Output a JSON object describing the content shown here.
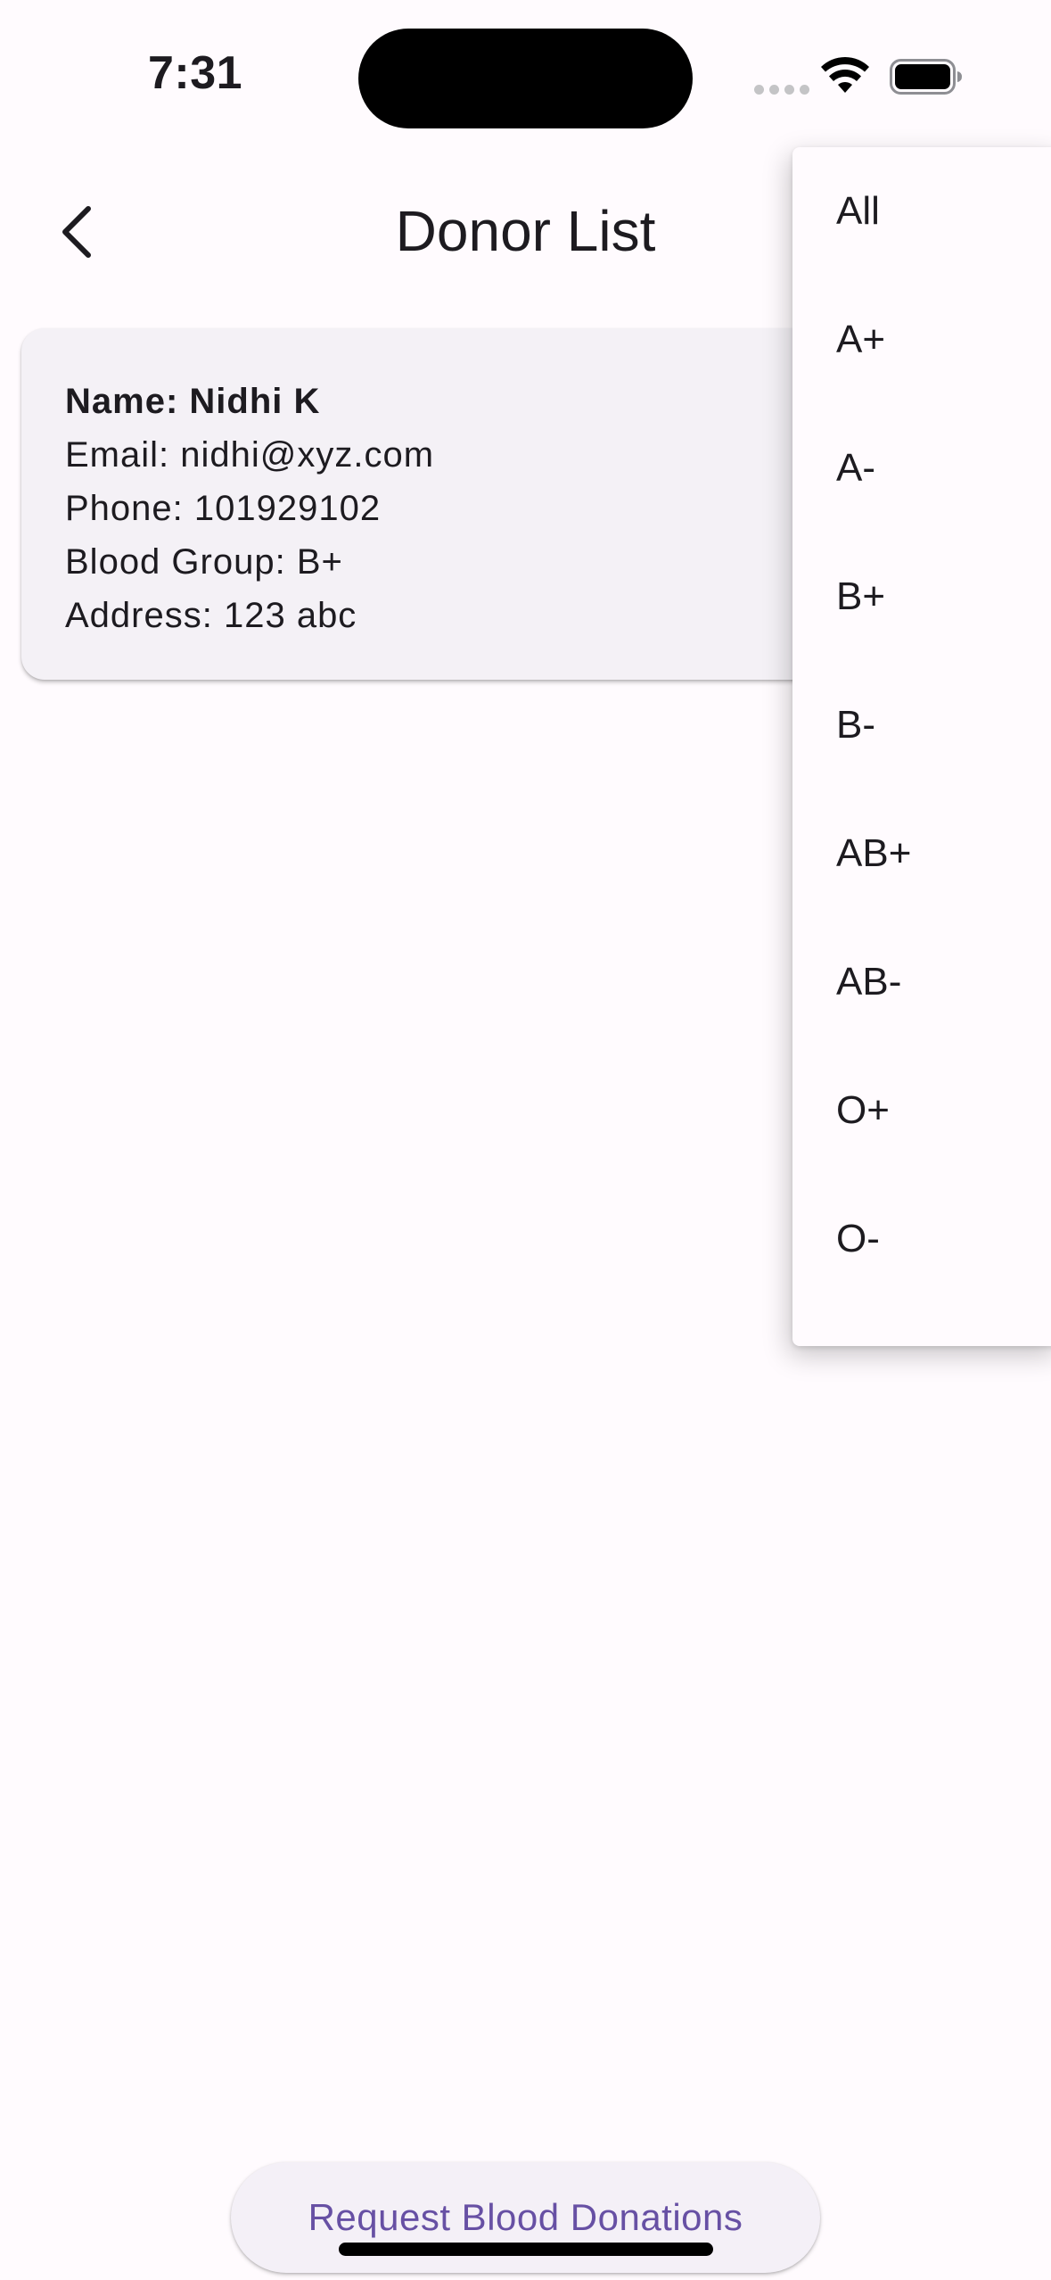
{
  "status_bar": {
    "time": "7:31",
    "wifi_icon": "wifi-icon",
    "battery_icon": "battery-icon"
  },
  "app_bar": {
    "title": "Donor List",
    "back_icon": "chevron-left-icon"
  },
  "donor": {
    "name": "Name: Nidhi K",
    "email": "Email: nidhi@xyz.com",
    "phone": "Phone: 101929102",
    "blood_group": "Blood Group: B+",
    "address": "Address: 123 abc"
  },
  "filter_menu": {
    "items": [
      "All",
      "A+",
      "A-",
      "B+",
      "B-",
      "AB+",
      "AB-",
      "O+",
      "O-"
    ]
  },
  "footer": {
    "request_label": "Request Blood Donations"
  },
  "colors": {
    "background": "#fffbfe",
    "card": "#f4f1f6",
    "accent": "#6750a4",
    "text": "#1d1b20"
  }
}
